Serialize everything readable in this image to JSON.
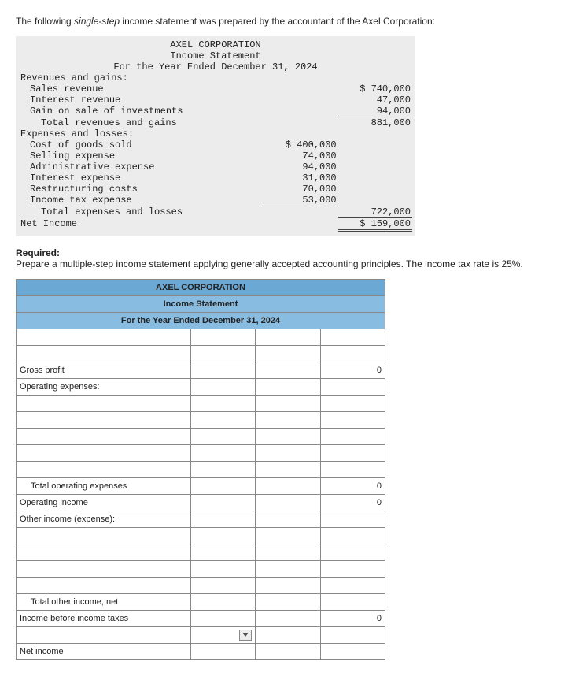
{
  "intro": {
    "prefix": "The following ",
    "italic": "single-step",
    "suffix": " income statement was prepared by the accountant of the Axel Corporation:"
  },
  "ss": {
    "company": "AXEL CORPORATION",
    "title": "Income Statement",
    "period": "For the Year Ended December 31, 2024",
    "rev_header": "Revenues and gains:",
    "sales_label": "Sales revenue",
    "sales_amt": "$ 740,000",
    "int_rev_label": "Interest revenue",
    "int_rev_amt": "47,000",
    "gain_label": "Gain on sale of investments",
    "gain_amt": "94,000",
    "total_rev_label": "Total revenues and gains",
    "total_rev_amt": "881,000",
    "exp_header": "Expenses and losses:",
    "cogs_label": "Cost of goods sold",
    "cogs_amt": "$ 400,000",
    "selling_label": "Selling expense",
    "selling_amt": "74,000",
    "admin_label": "Administrative expense",
    "admin_amt": "94,000",
    "intexp_label": "Interest expense",
    "intexp_amt": "31,000",
    "restr_label": "Restructuring costs",
    "restr_amt": "70,000",
    "tax_label": "Income tax expense",
    "tax_amt": "53,000",
    "total_exp_label": "Total expenses and losses",
    "total_exp_amt": "722,000",
    "net_label": "Net Income",
    "net_amt": "$ 159,000"
  },
  "required": {
    "heading": "Required:",
    "text": "Prepare a multiple-step income statement applying generally accepted accounting principles. The income tax rate is 25%."
  },
  "ws": {
    "company": "AXEL CORPORATION",
    "title": "Income Statement",
    "period": "For the Year Ended December 31, 2024",
    "gross_profit": "Gross profit",
    "op_exp": "Operating expenses:",
    "total_op_exp": "Total operating expenses",
    "op_income": "Operating income",
    "other": "Other income (expense):",
    "total_other": "Total other income, net",
    "inc_before_tax": "Income before income taxes",
    "net_income": "Net income",
    "zero": "0"
  }
}
